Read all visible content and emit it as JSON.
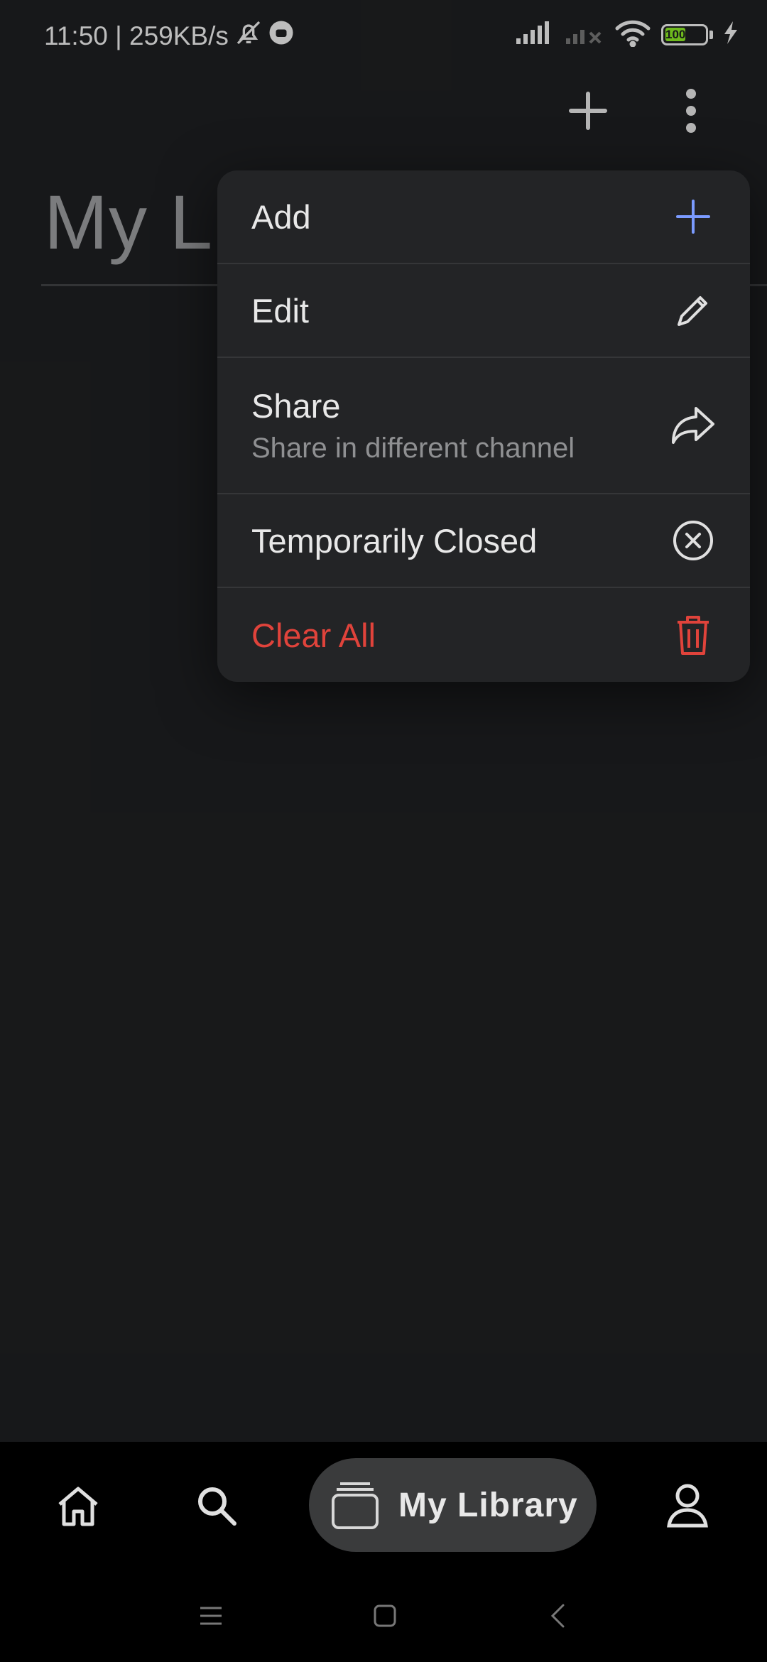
{
  "status_bar": {
    "time_speed": "11:50 | 259KB/s",
    "battery_level": "100",
    "battery_color": "#7ed321"
  },
  "appbar": {
    "add_icon": "plus-icon",
    "more_icon": "more-vertical-icon"
  },
  "page": {
    "title_partial": "My L"
  },
  "menu": {
    "items": [
      {
        "label": "Add",
        "icon": "plus-icon",
        "icon_color": "#7b9bff"
      },
      {
        "label": "Edit",
        "icon": "pencil-icon"
      },
      {
        "label": "Share",
        "sublabel": "Share in different channel",
        "icon": "share-arrow-icon"
      },
      {
        "label": "Temporarily Closed",
        "icon": "close-circle-icon"
      },
      {
        "label": "Clear All",
        "icon": "trash-icon",
        "color": "#e0433b"
      }
    ]
  },
  "bottom_nav": {
    "home_icon": "home-icon",
    "search_icon": "search-icon",
    "library_label": "My Library",
    "library_icon": "library-stack-icon",
    "profile_icon": "profile-icon"
  },
  "system_nav": {
    "menu_icon": "menu-lines-icon",
    "home_icon": "square-home-icon",
    "back_icon": "back-chevron-icon"
  }
}
